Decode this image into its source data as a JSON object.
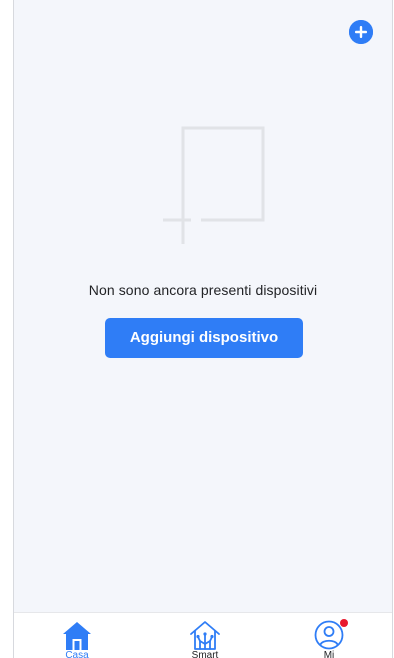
{
  "header": {
    "add_icon": "plus-circle-icon"
  },
  "empty_state": {
    "illustration": "empty-devices-icon",
    "message": "Non sono ancora presenti dispositivi",
    "button_label": "Aggiungi dispositivo"
  },
  "tabbar": {
    "tabs": [
      {
        "label": "Casa",
        "icon": "home-icon",
        "active": true
      },
      {
        "label": "Smart",
        "icon": "smart-home-icon",
        "active": false
      },
      {
        "label": "Mi",
        "icon": "profile-icon",
        "active": false,
        "badge": true
      }
    ]
  },
  "colors": {
    "accent": "#2f7df6",
    "background": "#f4f6fb",
    "badge": "#e8182d"
  }
}
